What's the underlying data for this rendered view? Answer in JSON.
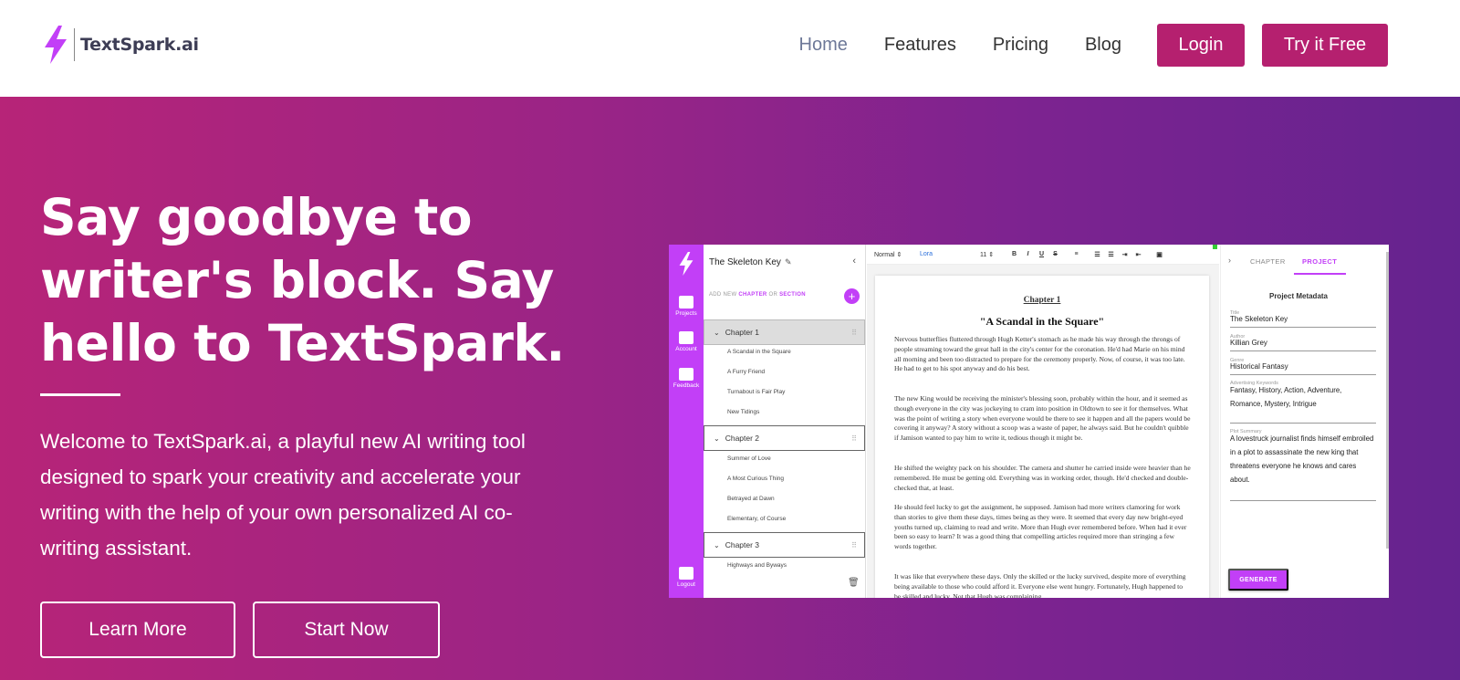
{
  "brand": {
    "name": "TextSpark.ai",
    "accent": "#b5206f",
    "bolt_color": "#c23ff7"
  },
  "nav": {
    "links": [
      {
        "label": "Home",
        "active": true
      },
      {
        "label": "Features",
        "active": false
      },
      {
        "label": "Pricing",
        "active": false
      },
      {
        "label": "Blog",
        "active": false
      }
    ],
    "login_label": "Login",
    "try_label": "Try it Free"
  },
  "hero": {
    "headline": "Say goodbye to writer's block. Say hello to TextSpark.",
    "intro": "Welcome to TextSpark.ai, a playful new AI writing tool designed to spark your creativity and accelerate your writing with the help of your own personalized AI co-writing assistant.",
    "learn_more": "Learn More",
    "start_now": "Start Now"
  },
  "app": {
    "rail": {
      "projects": "Projects",
      "account": "Account",
      "feedback": "Feedback",
      "logout": "Logout"
    },
    "outline": {
      "project_title": "The Skeleton Key",
      "add_new_prefix": "ADD NEW",
      "add_chapter": "CHAPTER",
      "add_or": "OR",
      "add_section": "SECTION",
      "chapters": [
        {
          "label": "Chapter 1",
          "sections": [
            "A Scandal in the Square",
            "A Furry Friend",
            "Turnabout is Fair Play",
            "New Tidings"
          ]
        },
        {
          "label": "Chapter 2",
          "sections": [
            "Summer of Love",
            "A Most Curious Thing",
            "Betrayed at Dawn",
            "Elementary, of Course"
          ]
        },
        {
          "label": "Chapter 3",
          "sections": [
            "Highways and Byways"
          ]
        }
      ]
    },
    "toolbar": {
      "style": "Normal",
      "font": "Lora",
      "size": "11",
      "bold": "B",
      "italic": "I",
      "underline": "U",
      "strike": "S"
    },
    "document": {
      "chapter": "Chapter 1",
      "title": "\"A Scandal in the Square\"",
      "paragraphs": [
        "Nervous butterflies fluttered through Hugh Ketter's stomach as he made his way through the throngs of people streaming toward the great hall in the city's center for the coronation. He'd had Marie on his mind all morning and been too distracted to prepare for the ceremony properly. Now, of course, it was too late. He had to get to his spot anyway and do his best.",
        "The new King would be receiving the minister's blessing soon, probably within the hour, and it seemed as though everyone in the city was jockeying to cram into position in Oldtown to see it for themselves. What was the point of writing a story when everyone would be there to see it happen and all the papers would be covering it anyway? A story without a scoop was a waste of paper, he always said. But he couldn't quibble if Jamison wanted to pay him to write it, tedious though it might be.",
        "He shifted the weighty pack on his shoulder. The camera and shutter he carried inside were heavier than he remembered. He must be getting old. Everything was in working order, though. He'd checked and double-checked that, at least.",
        "He should feel lucky to get the assignment, he supposed. Jamison had more writers clamoring for work than stories to give them these days, times being as they were. It seemed that every day new bright-eyed youths turned up, claiming to read and write. More than Hugh ever remembered before. When had it ever been so easy to learn? It was a good thing that compelling articles required more than stringing a few words together.",
        "It was like that everywhere these days. Only the skilled or the lucky survived, despite more of everything being available to those who could afford it. Everyone else went hungry. Fortunately, Hugh happened to be skilled and lucky. Not that Hugh was complaining."
      ]
    },
    "panel": {
      "tab_chapter": "CHAPTER",
      "tab_project": "PROJECT",
      "heading": "Project Metadata",
      "title_label": "Title",
      "title_value": "The Skeleton Key",
      "author_label": "Author",
      "author_value": "Killian Grey",
      "genre_label": "Genre",
      "genre_value": "Historical Fantasy",
      "keywords_label": "Advertising Keywords",
      "keywords_value": "Fantasy, History, Action, Adventure, Romance, Mystery, Intrigue",
      "summary_label": "Plot Summary",
      "summary_value": "A lovestruck journalist finds himself embroiled in a plot to assassinate the new king that threatens everyone he knows and cares about.",
      "generate": "GENERATE"
    }
  }
}
